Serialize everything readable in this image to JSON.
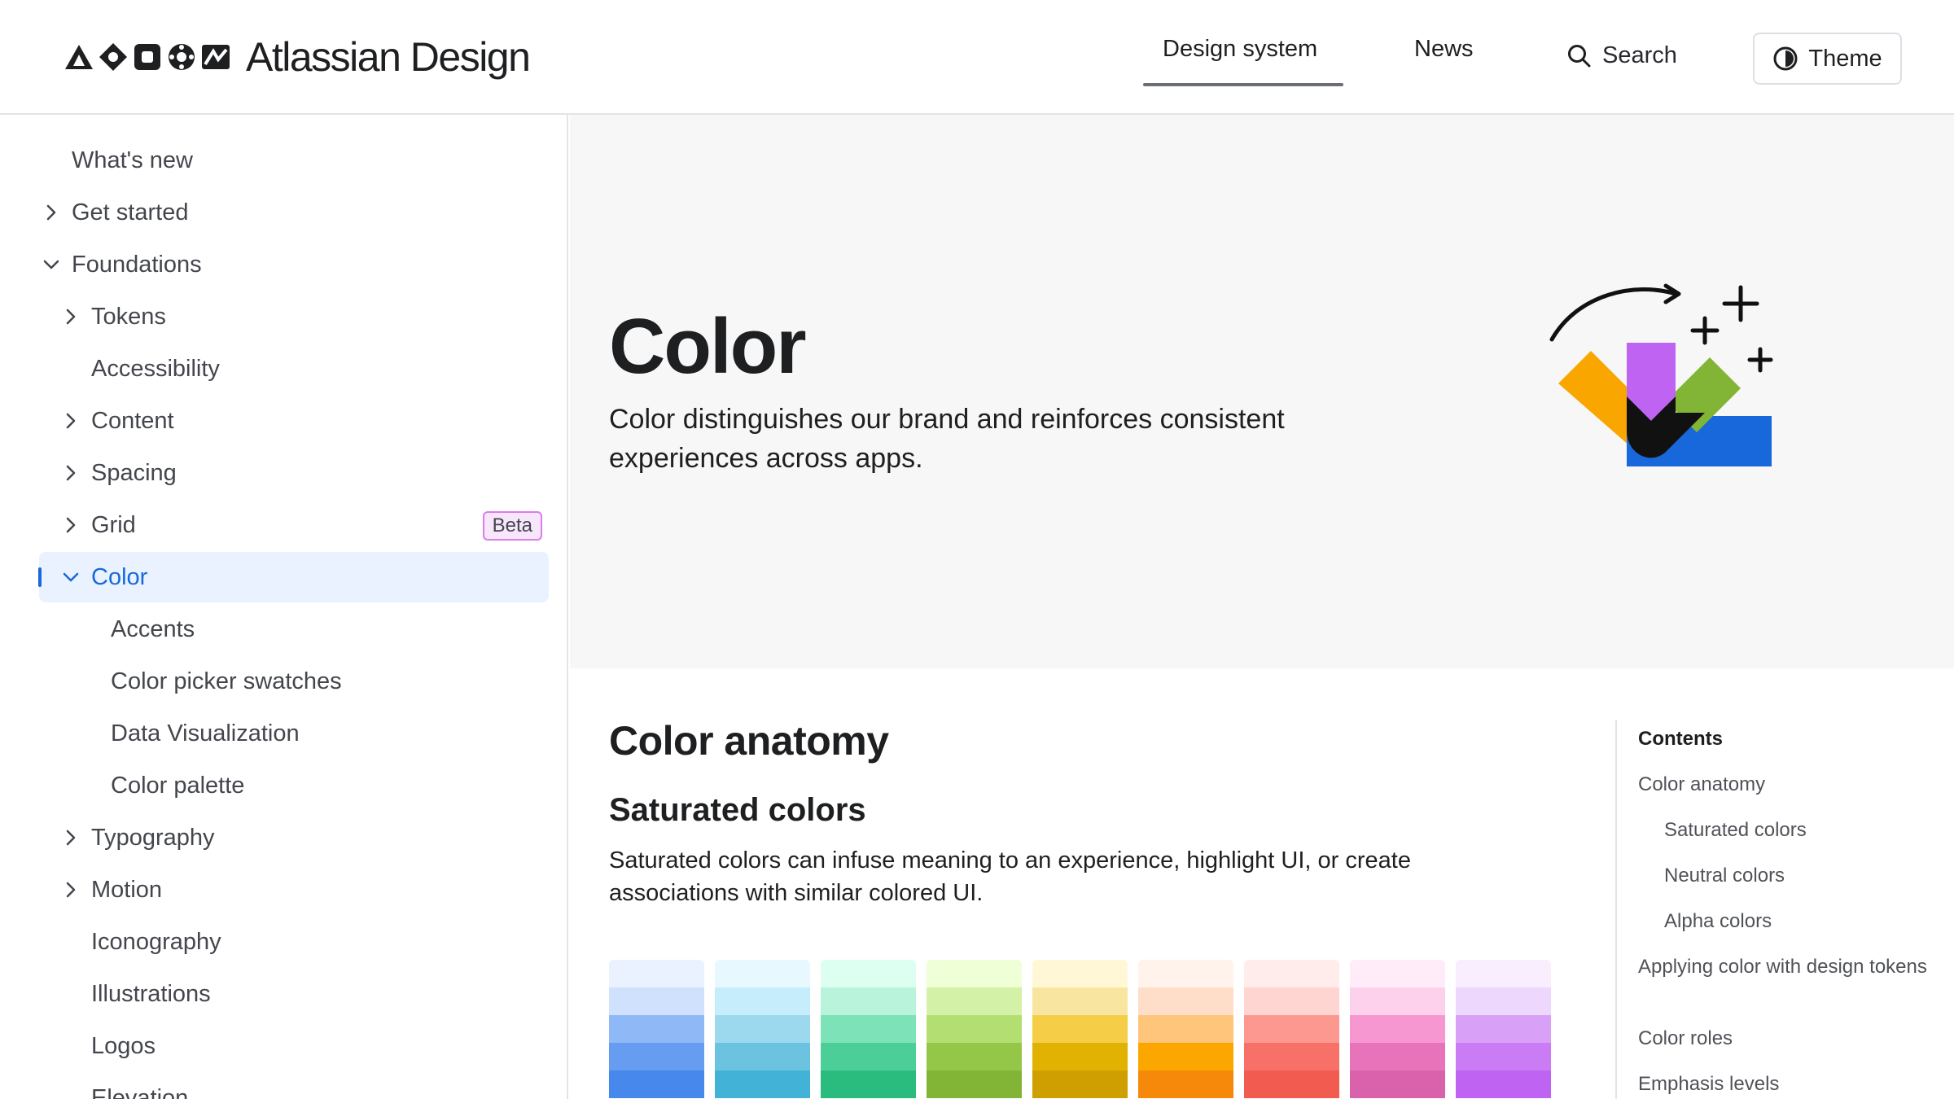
{
  "header": {
    "brand": "Atlassian Design",
    "nav": [
      "Design system",
      "News"
    ],
    "search_label": "Search",
    "theme_label": "Theme"
  },
  "sidebar": {
    "items": [
      {
        "label": "What's new",
        "depth": 0,
        "chevron": "none"
      },
      {
        "label": "Get started",
        "depth": 0,
        "chevron": "right"
      },
      {
        "label": "Foundations",
        "depth": 0,
        "chevron": "down"
      },
      {
        "label": "Tokens",
        "depth": 1,
        "chevron": "right"
      },
      {
        "label": "Accessibility",
        "depth": 1,
        "chevron": "none"
      },
      {
        "label": "Content",
        "depth": 1,
        "chevron": "right"
      },
      {
        "label": "Spacing",
        "depth": 1,
        "chevron": "right"
      },
      {
        "label": "Grid",
        "depth": 1,
        "chevron": "right",
        "badge": "Beta"
      },
      {
        "label": "Color",
        "depth": 1,
        "chevron": "down",
        "selected": true
      },
      {
        "label": "Accents",
        "depth": 2,
        "chevron": "none"
      },
      {
        "label": "Color picker swatches",
        "depth": 2,
        "chevron": "none"
      },
      {
        "label": "Data Visualization",
        "depth": 2,
        "chevron": "none"
      },
      {
        "label": "Color palette",
        "depth": 2,
        "chevron": "none"
      },
      {
        "label": "Typography",
        "depth": 1,
        "chevron": "right"
      },
      {
        "label": "Motion",
        "depth": 1,
        "chevron": "right"
      },
      {
        "label": "Iconography",
        "depth": 1,
        "chevron": "none"
      },
      {
        "label": "Illustrations",
        "depth": 1,
        "chevron": "none"
      },
      {
        "label": "Logos",
        "depth": 1,
        "chevron": "none"
      },
      {
        "label": "Elevation",
        "depth": 1,
        "chevron": "none"
      }
    ]
  },
  "hero": {
    "title": "Color",
    "description": "Color distinguishes our brand and reinforces consistent experiences across apps."
  },
  "content": {
    "heading": "Color anatomy",
    "subheading": "Saturated colors",
    "paragraph": "Saturated colors can infuse meaning to an experience, highlight UI, or create associations with similar colored UI.",
    "swatches": [
      {
        "name": "blue",
        "shades": [
          "#e9f2fe",
          "#cfe1fd",
          "#8fb8f6",
          "#669df1",
          "#4688ec"
        ]
      },
      {
        "name": "teal",
        "shades": [
          "#e7f9ff",
          "#c6edfb",
          "#9dd9ee",
          "#6cc3e0",
          "#42b2d7"
        ]
      },
      {
        "name": "green",
        "shades": [
          "#dcfff1",
          "#baf3db",
          "#7ee2b8",
          "#4bce97",
          "#2abb7f"
        ]
      },
      {
        "name": "lime",
        "shades": [
          "#efffd6",
          "#d3f1a7",
          "#b3df72",
          "#94c748",
          "#82b536"
        ]
      },
      {
        "name": "yellow",
        "shades": [
          "#fff7d6",
          "#f8e6a0",
          "#f5cd47",
          "#e2b203",
          "#cf9f02"
        ]
      },
      {
        "name": "orange",
        "shades": [
          "#fff3eb",
          "#fedec8",
          "#fec57b",
          "#fca700",
          "#f68909"
        ]
      },
      {
        "name": "red",
        "shades": [
          "#ffeceb",
          "#ffd5d2",
          "#fd9891",
          "#f87168",
          "#f15b50"
        ]
      },
      {
        "name": "magenta",
        "shades": [
          "#ffecf8",
          "#fdd0ec",
          "#f797d2",
          "#e774bb",
          "#da62ac"
        ]
      },
      {
        "name": "purple",
        "shades": [
          "#f8eefe",
          "#eed7fc",
          "#d8a0f7",
          "#c97cf4",
          "#bf63f3"
        ]
      }
    ]
  },
  "toc": {
    "title": "Contents",
    "items": [
      {
        "label": "Color anatomy",
        "indent": false
      },
      {
        "label": "Saturated colors",
        "indent": true
      },
      {
        "label": "Neutral colors",
        "indent": true
      },
      {
        "label": "Alpha colors",
        "indent": true
      },
      {
        "label": "Applying color with design tokens",
        "indent": false
      },
      {
        "label": "Color roles",
        "indent": false
      },
      {
        "label": "Emphasis levels",
        "indent": false
      }
    ]
  },
  "colors": {
    "accent": "#1868db",
    "selected_bg": "#e9f2fe",
    "hero_bg": "#f7f7f7",
    "beta_bg": "#f8e6fc"
  }
}
